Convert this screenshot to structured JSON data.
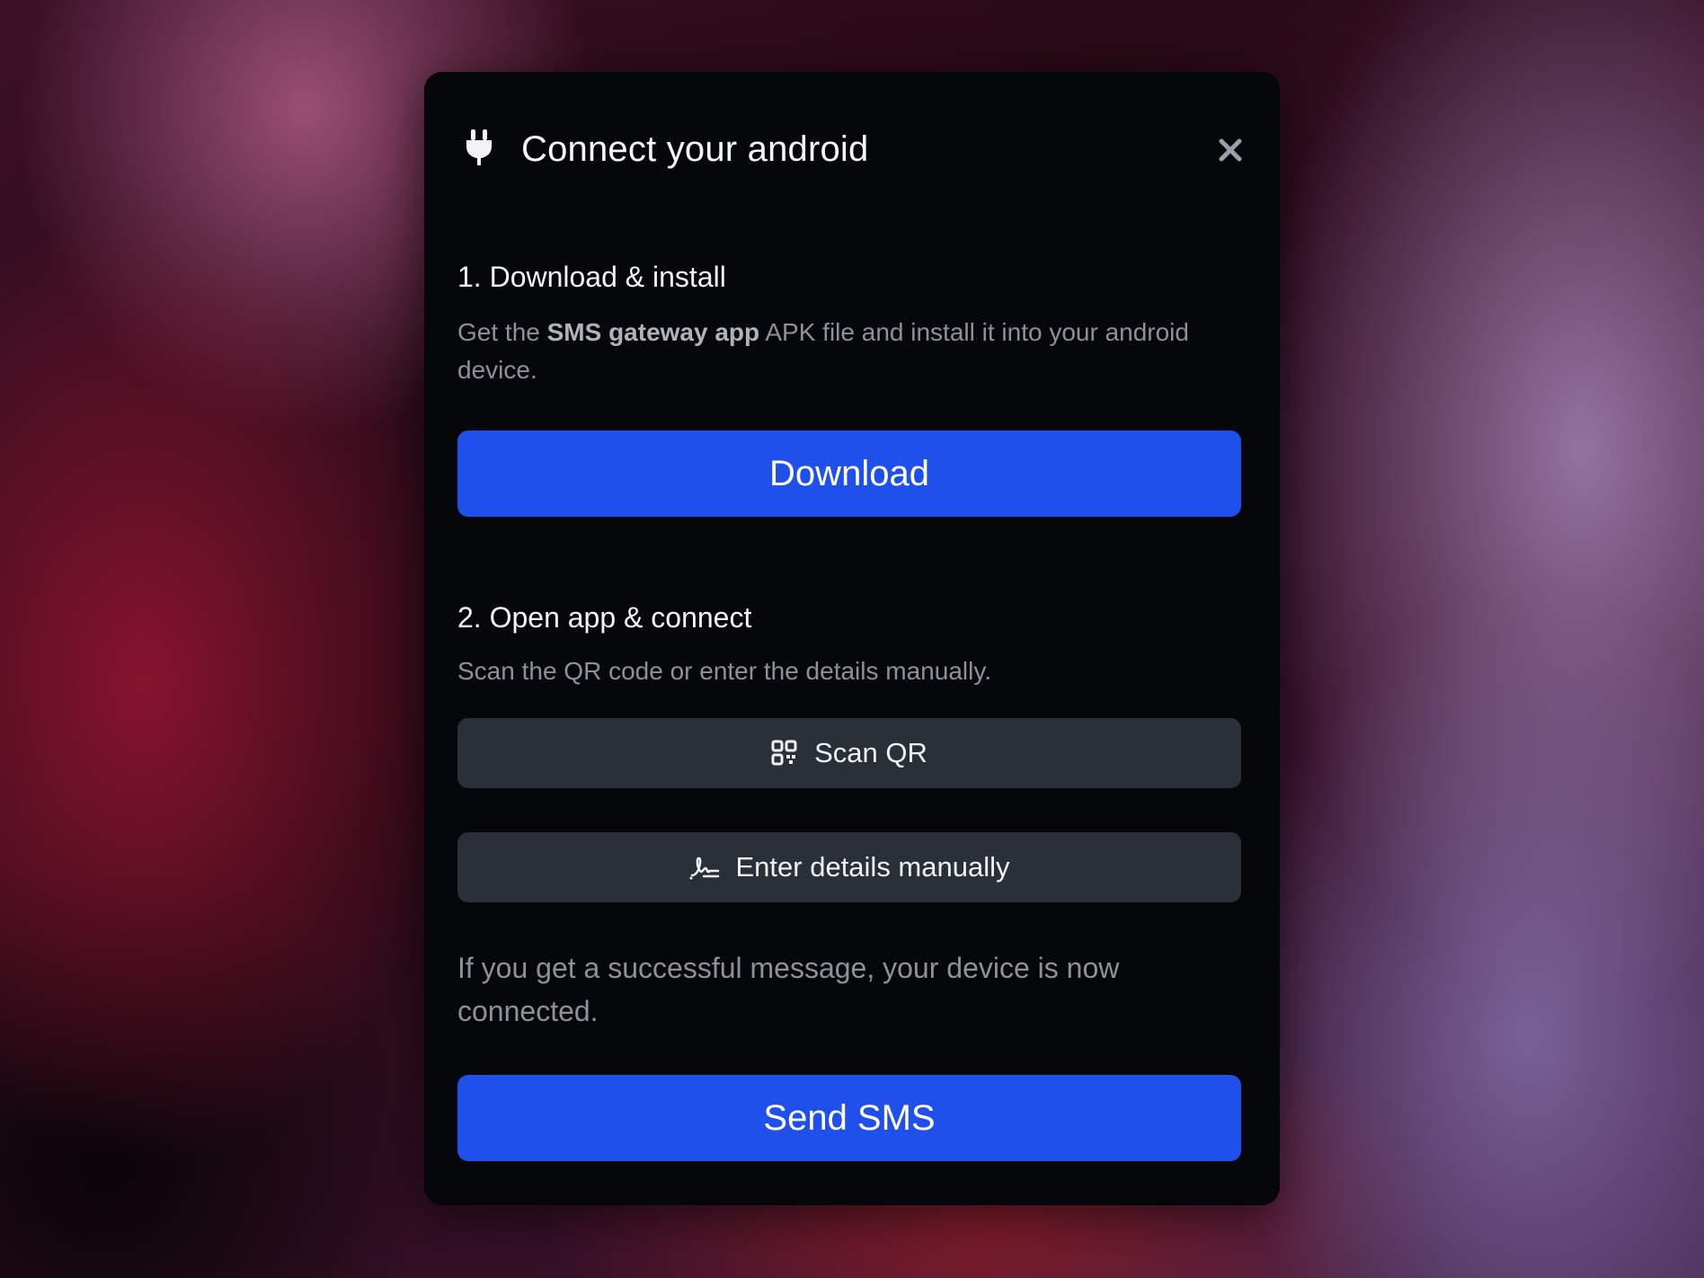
{
  "modal": {
    "title": "Connect your android",
    "close_icon": "close-icon",
    "header_icon": "plug-icon"
  },
  "step1": {
    "heading": "1. Download & install",
    "text_prefix": "Get the ",
    "text_bold": "SMS gateway app",
    "text_suffix": " APK file and install it into your android device.",
    "button_label": "Download"
  },
  "step2": {
    "heading": "2. Open app & connect",
    "text": "Scan the QR code or enter the details manually.",
    "scan_button_label": "Scan QR",
    "scan_button_icon": "qr-code-icon",
    "manual_button_label": "Enter details manually",
    "manual_button_icon": "signature-icon"
  },
  "footer": {
    "text": "If you get a successful message, your device is now connected.",
    "button_label": "Send SMS"
  },
  "colors": {
    "primary": "#2050ec",
    "modal_bg": "#05070a",
    "secondary_button": "#2b3038",
    "muted_text": "#8c929b"
  }
}
